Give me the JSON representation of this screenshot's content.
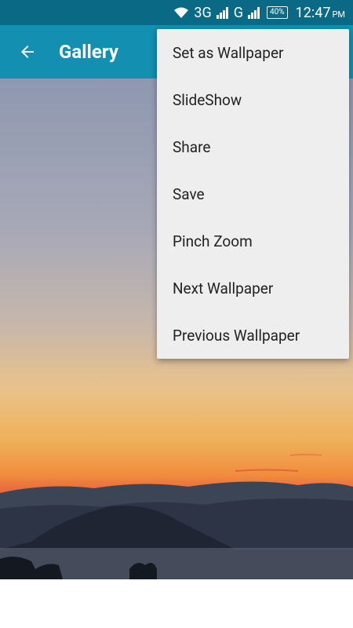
{
  "status_bar": {
    "network1": "3G",
    "network2": "G",
    "battery": "40%",
    "time": "12:47",
    "ampm": "PM"
  },
  "app_bar": {
    "title": "Gallery"
  },
  "menu": {
    "items": [
      {
        "label": "Set as Wallpaper"
      },
      {
        "label": "SlideShow"
      },
      {
        "label": "Share"
      },
      {
        "label": "Save"
      },
      {
        "label": "Pinch Zoom"
      },
      {
        "label": "Next Wallpaper"
      },
      {
        "label": "Previous Wallpaper"
      }
    ]
  },
  "colors": {
    "status_bar": "#0a6a85",
    "app_bar": "#128fb1",
    "menu_bg": "#eeeeee"
  }
}
